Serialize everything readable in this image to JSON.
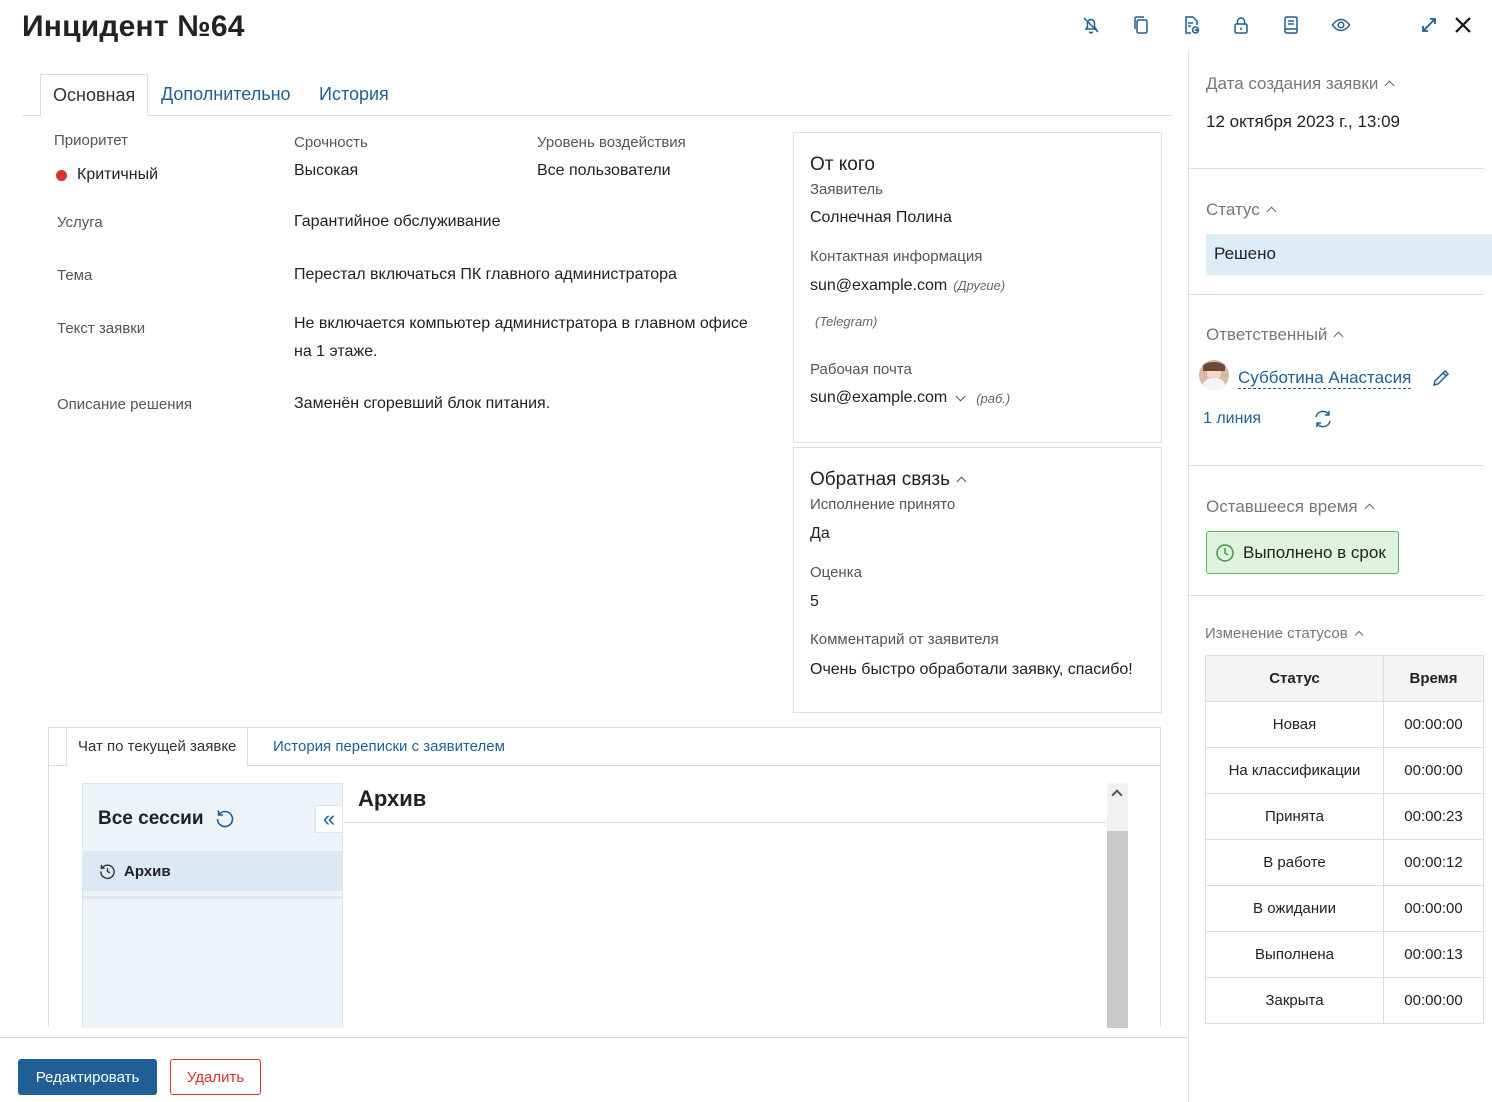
{
  "header": {
    "title": "Инцидент №64"
  },
  "tabs": [
    {
      "label": "Основная"
    },
    {
      "label": "Дополнительно"
    },
    {
      "label": "История"
    }
  ],
  "fields": {
    "priority_label": "Приоритет",
    "priority_value": "Критичный",
    "urgency_label": "Срочность",
    "urgency_value": "Высокая",
    "impact_label": "Уровень воздействия",
    "impact_value": "Все пользователи",
    "service_label": "Услуга",
    "service_value": "Гарантийное обслуживание",
    "topic_label": "Тема",
    "topic_value": "Перестал включаться ПК главного администратора",
    "text_label": "Текст заявки",
    "text_value_line1": "Не включается компьютер администратора в главном офисе",
    "text_value_line2": "на 1 этаже.",
    "solution_label": "Описание решения",
    "solution_value": "Заменён сгоревший блок питания."
  },
  "from": {
    "title": "От кого",
    "applicant_label": "Заявитель",
    "applicant_value": "Солнечная Полина",
    "contact_label": "Контактная информация",
    "contact_email": "sun@example.com",
    "contact_note": "(Другие)",
    "contact_telegram": "(Telegram)",
    "work_email_label": "Рабочая почта",
    "work_email_value": "sun@example.com",
    "work_email_note": "(раб.)"
  },
  "feedback": {
    "title": "Обратная связь",
    "accepted_label": "Исполнение принято",
    "accepted_value": "Да",
    "rating_label": "Оценка",
    "rating_value": "5",
    "comment_label": "Комментарий от заявителя",
    "comment_value": "Очень быстро обработали заявку, спасибо!"
  },
  "chat": {
    "tab_current": "Чат по текущей заявке",
    "tab_history": "История переписки с заявителем",
    "sessions_title": "Все сессии",
    "archive_item": "Архив",
    "panel_title": "Архив"
  },
  "sidebar": {
    "created_label": "Дата создания заявки",
    "created_value": "12 октября 2023 г., 13:09",
    "status_label": "Статус",
    "status_value": "Решено",
    "responsible_label": "Ответственный",
    "responsible_name": "Субботина Анастасия",
    "responsible_line": "1 линия",
    "remaining_label": "Оставшееся время",
    "remaining_value": "Выполнено в срок",
    "status_changes_label": "Изменение статусов",
    "table_headers": [
      "Статус",
      "Время"
    ],
    "status_rows": [
      {
        "status": "Новая",
        "time": "00:00:00"
      },
      {
        "status": "На классификации",
        "time": "00:00:00"
      },
      {
        "status": "Принята",
        "time": "00:00:23"
      },
      {
        "status": "В работе",
        "time": "00:00:12"
      },
      {
        "status": "В ожидании",
        "time": "00:00:00"
      },
      {
        "status": "Выполнена",
        "time": "00:00:13"
      },
      {
        "status": "Закрыта",
        "time": "00:00:00"
      }
    ]
  },
  "footer": {
    "edit_label": "Редактировать",
    "delete_label": "Удалить"
  },
  "colors": {
    "accent": "#1f5f95",
    "critical": "#e03030",
    "status_bg": "#dcedf7",
    "success_bg": "#dff3df",
    "success_border": "#5cb85c",
    "delete": "#d9302c"
  }
}
